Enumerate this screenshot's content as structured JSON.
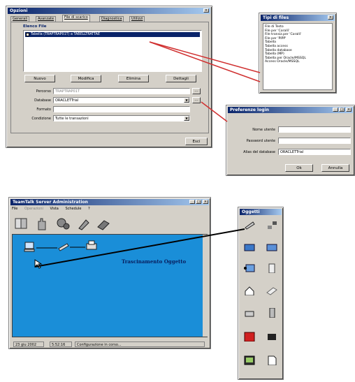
{
  "options_window": {
    "title": "Opzioni",
    "tabs": [
      "Generali",
      "Avanzate",
      "File di scarico",
      "Diagnostica",
      "Utilizzi"
    ],
    "group_label": "Elenco File",
    "list_row": "Tabella (TRAPTRAP01T) a TABELLTRATTAE",
    "buttons": [
      "Nuovo",
      "Modifica",
      "Elimina",
      "Dettagli"
    ],
    "fields": [
      {
        "label": "Percorso",
        "value": "TRAPTRAP01T"
      },
      {
        "label": "Database",
        "value": "ORACLETTrial"
      },
      {
        "label": "Formato",
        "value": ""
      },
      {
        "label": "Condizione",
        "value": "Tutte le transazioni"
      }
    ],
    "exit_button": "Esci"
  },
  "file_type_window": {
    "title": "Tipi di files",
    "items": [
      "File di Testo",
      "File per 'Coralli'",
      "File transiz.per 'Coralli'",
      "File per 'PIPP'",
      "Tabella",
      "Tabella access",
      "Tabella database",
      "Tabella (MP)",
      "Tabella per Oracle/MSSQL",
      "Access Oracle/MSSQL"
    ]
  },
  "db_pref_window": {
    "title": "Preferenze login",
    "fields": [
      {
        "label": "Nome utente",
        "value": ""
      },
      {
        "label": "Password utente",
        "value": ""
      },
      {
        "label": "Alias del database",
        "value": "ORACLETTrial"
      }
    ],
    "ok": "Ok",
    "cancel": "Annulla"
  },
  "admin_window": {
    "title": "TeamTalk Server Administration",
    "menu": [
      "File",
      "Operazioni",
      "Vista",
      "Schedule",
      "?"
    ],
    "annotation": "Trascinamento Oggetto",
    "status": [
      "23 giu 2002",
      "5:52:16",
      "Configurazione in corso..."
    ]
  },
  "objects_palette": {
    "title": "Oggetti",
    "icons": [
      "modem-icon",
      "network-icon",
      "server-icon",
      "server-alt-icon",
      "terminal-icon",
      "cabinet-icon",
      "home-icon",
      "tag-icon",
      "printer-icon",
      "tower-icon",
      "fire-icon",
      "phone-icon",
      "monitor-icon",
      "document-icon"
    ]
  },
  "colors": {
    "accent": "#0a246a",
    "desktop": "#1a8ed8",
    "arrow": "#d03030"
  }
}
